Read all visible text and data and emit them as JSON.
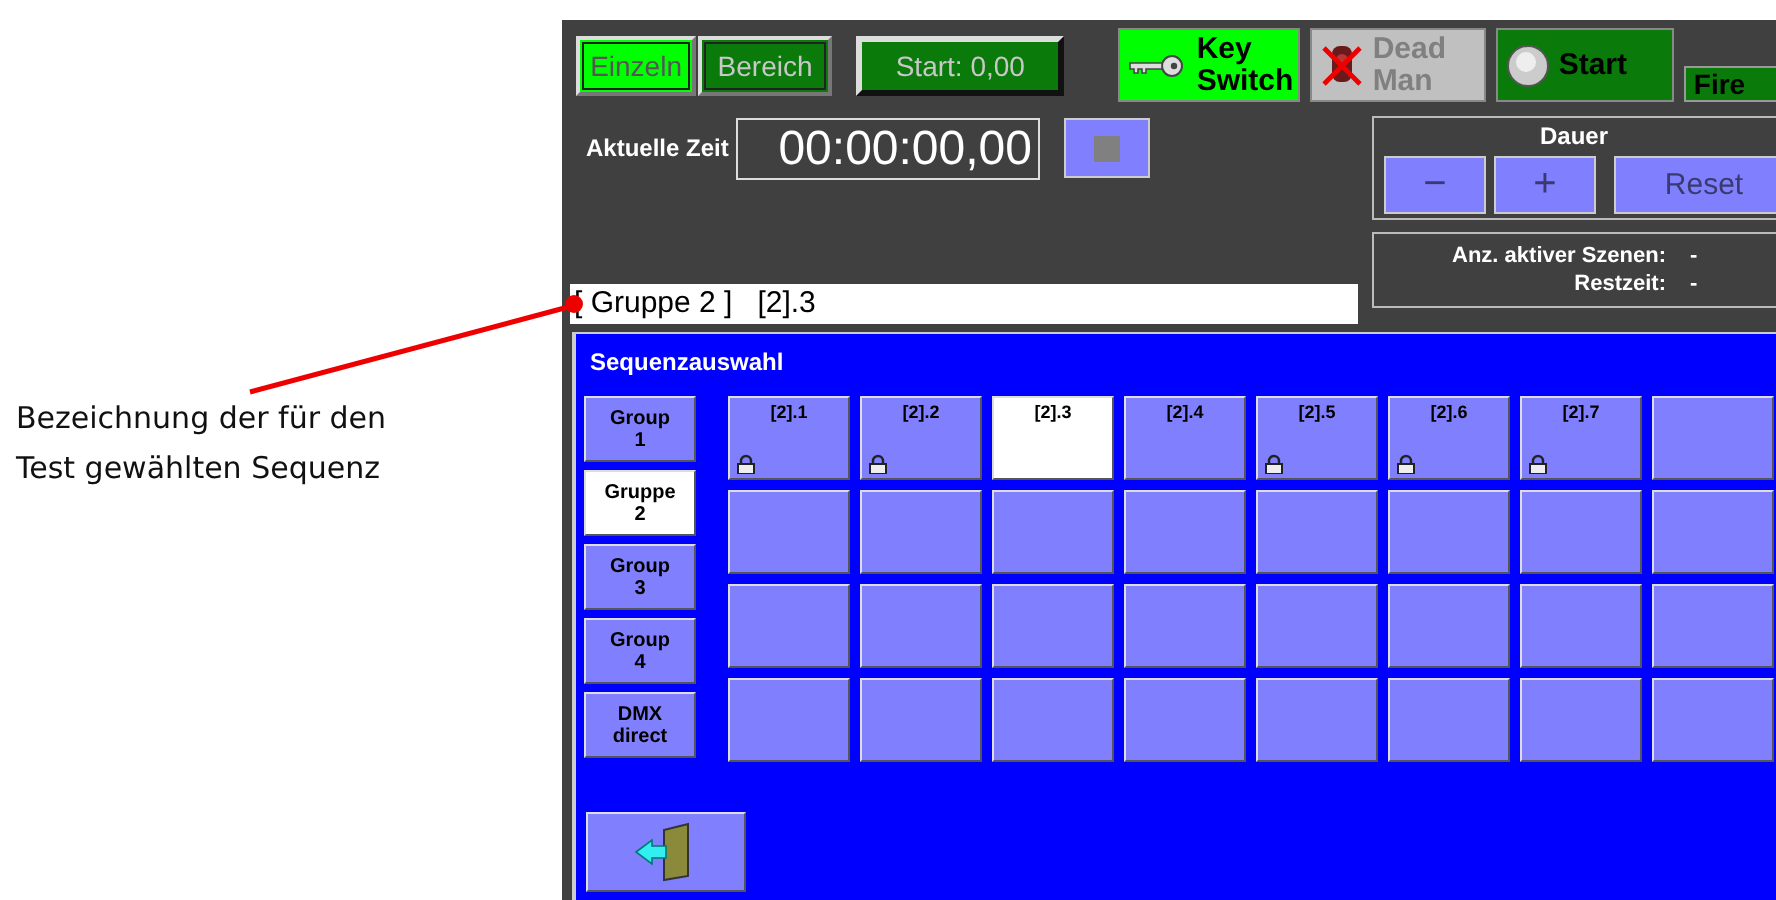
{
  "annotation": {
    "text": "Bezeichnung der für den Test gewählten Sequenz"
  },
  "mode_buttons": [
    {
      "label": "Einzeln",
      "selected": true
    },
    {
      "label": "Bereich",
      "selected": false
    }
  ],
  "start_field": {
    "value": "Start: 0,00"
  },
  "key_switch": {
    "label": "Key Switch",
    "on": true
  },
  "dead_man": {
    "label": "Dead Man",
    "disabled": true
  },
  "start_button": {
    "label": "Start"
  },
  "fire_button": {
    "label": "Fire"
  },
  "time": {
    "label": "Aktuelle Zeit",
    "value": "00:00:00,00"
  },
  "dauer": {
    "title": "Dauer",
    "buttons": [
      {
        "label": "−",
        "disabled": true
      },
      {
        "label": "+",
        "disabled": true
      },
      {
        "label": "Reset",
        "disabled": true
      }
    ]
  },
  "selection_field": {
    "value": "[ Gruppe 2 ]   [2].3"
  },
  "info": [
    {
      "label": "Anz. aktiver Szenen:",
      "value": "-"
    },
    {
      "label": "Restzeit:",
      "value": "-"
    }
  ],
  "sequence_panel": {
    "title": "Sequenzauswahl",
    "groups": [
      {
        "label": "Group 1",
        "selected": false
      },
      {
        "label": "Gruppe 2",
        "selected": true
      },
      {
        "label": "Group 3",
        "selected": false
      },
      {
        "label": "Group 4",
        "selected": false
      },
      {
        "label": "DMX direct",
        "selected": false
      }
    ],
    "tiles": [
      {
        "label": "[2].1",
        "locked": true,
        "selected": false
      },
      {
        "label": "[2].2",
        "locked": true,
        "selected": false
      },
      {
        "label": "[2].3",
        "locked": false,
        "selected": true
      },
      {
        "label": "[2].4",
        "locked": false,
        "selected": false
      },
      {
        "label": "[2].5",
        "locked": true,
        "selected": false
      },
      {
        "label": "[2].6",
        "locked": true,
        "selected": false
      },
      {
        "label": "[2].7",
        "locked": true,
        "selected": false
      },
      {
        "locked": false,
        "selected": false
      },
      {
        "locked": false,
        "selected": false
      },
      {
        "locked": false,
        "selected": false
      },
      {
        "locked": false,
        "selected": false
      },
      {
        "locked": false,
        "selected": false
      },
      {
        "locked": false,
        "selected": false
      },
      {
        "locked": false,
        "selected": false
      },
      {
        "locked": false,
        "selected": false
      },
      {
        "locked": false,
        "selected": false
      },
      {
        "locked": false,
        "selected": false
      },
      {
        "locked": false,
        "selected": false
      },
      {
        "locked": false,
        "selected": false
      },
      {
        "locked": false,
        "selected": false
      },
      {
        "locked": false,
        "selected": false
      },
      {
        "locked": false,
        "selected": false
      },
      {
        "locked": false,
        "selected": false
      },
      {
        "locked": false,
        "selected": false
      },
      {
        "locked": false,
        "selected": false
      },
      {
        "locked": false,
        "selected": false
      },
      {
        "locked": false,
        "selected": false
      },
      {
        "locked": false,
        "selected": false
      },
      {
        "locked": false,
        "selected": false
      },
      {
        "locked": false,
        "selected": false
      },
      {
        "locked": false,
        "selected": false
      },
      {
        "locked": false,
        "selected": false
      }
    ]
  }
}
